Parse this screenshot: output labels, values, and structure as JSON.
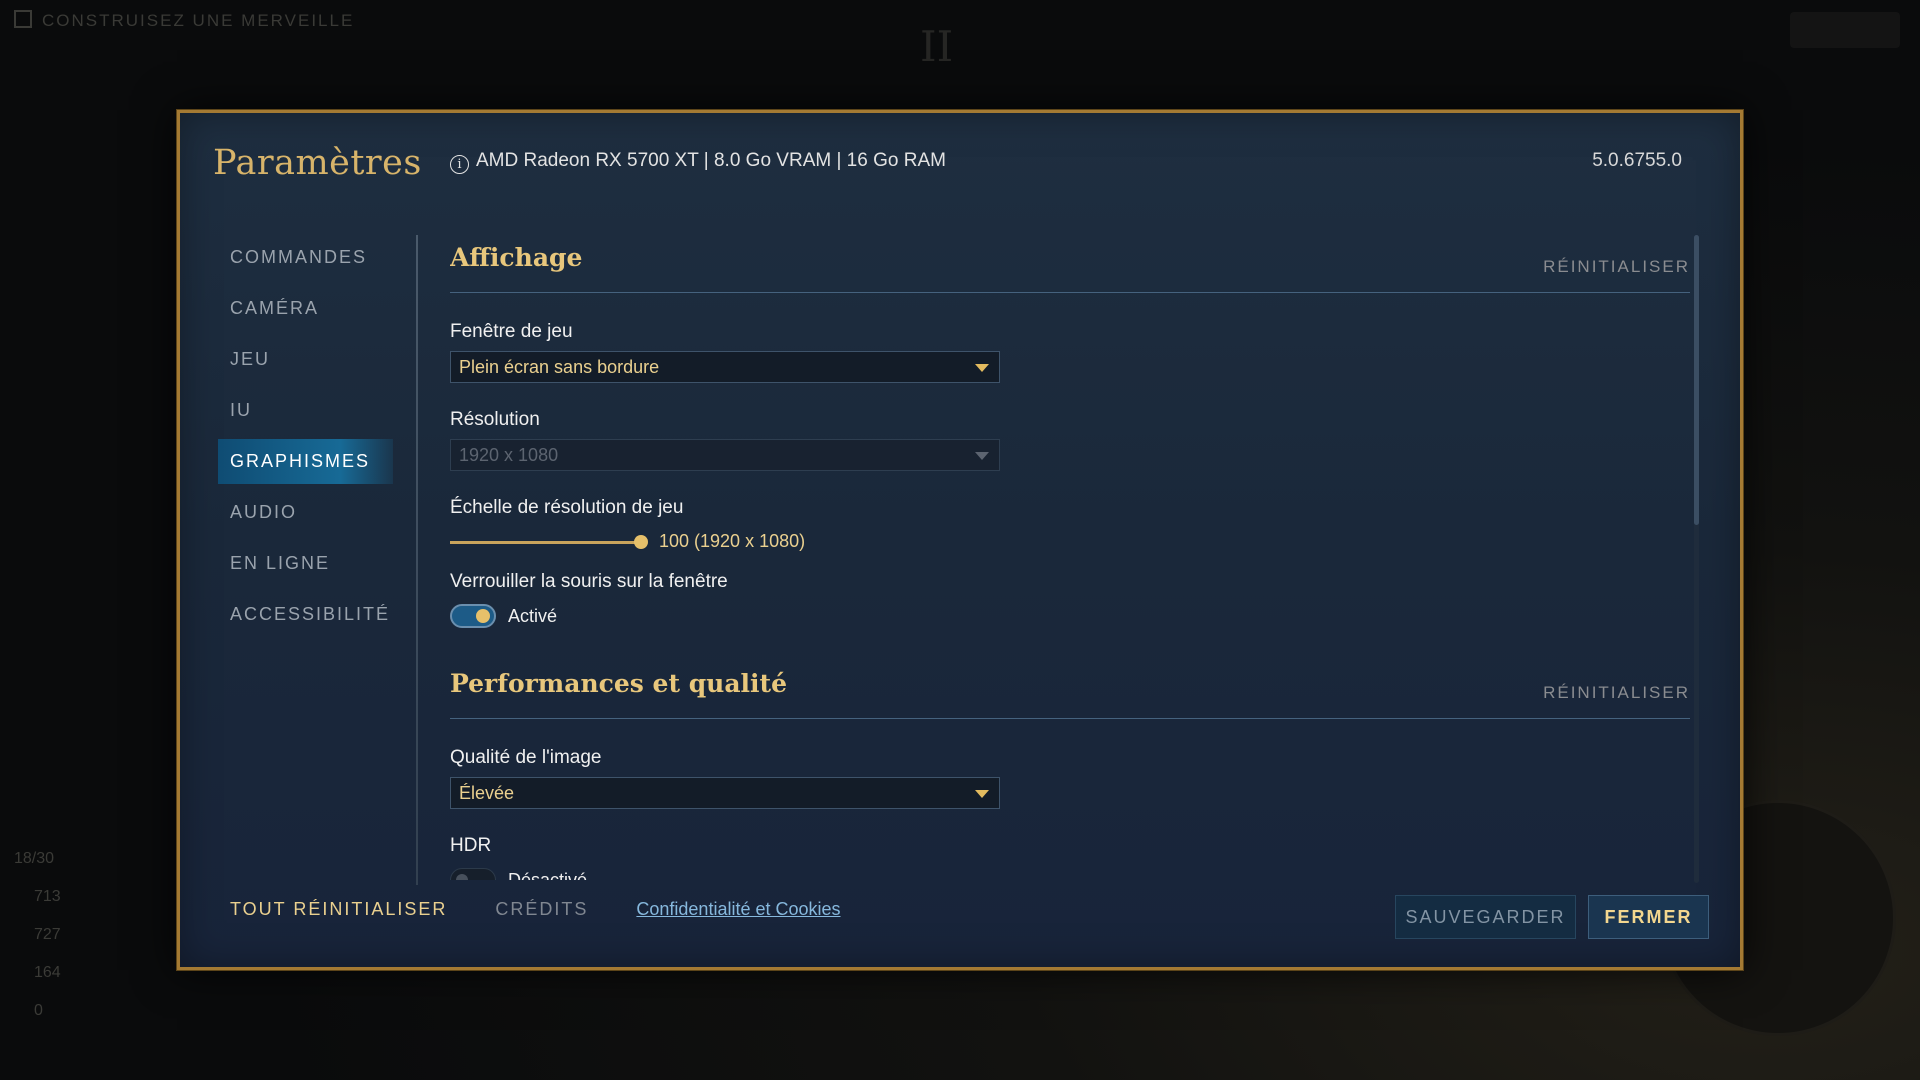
{
  "background": {
    "top_left_text": "CONSTRUISEZ UNE MERVEILLE",
    "top_center": "II",
    "stats": [
      "18/30",
      "713",
      "727",
      "164",
      "0"
    ]
  },
  "modal": {
    "title": "Paramètres",
    "system_info": "AMD Radeon RX 5700 XT | 8.0 Go VRAM | 16 Go RAM",
    "version": "5.0.6755.0"
  },
  "sidebar": {
    "items": [
      {
        "label": "COMMANDES"
      },
      {
        "label": "CAMÉRA"
      },
      {
        "label": "JEU"
      },
      {
        "label": "IU"
      },
      {
        "label": "GRAPHISMES"
      },
      {
        "label": "AUDIO"
      },
      {
        "label": "EN LIGNE"
      },
      {
        "label": "ACCESSIBILITÉ"
      }
    ],
    "active_index": 4
  },
  "sections": {
    "display": {
      "title": "Affichage",
      "reset_label": "RÉINITIALISER",
      "window_label": "Fenêtre de jeu",
      "window_value": "Plein écran sans bordure",
      "resolution_label": "Résolution",
      "resolution_value": "1920 x 1080",
      "scale_label": "Échelle de résolution de jeu",
      "scale_value_text": "100  (1920 x 1080)",
      "scale_fraction": 1.0,
      "mouse_lock_label": "Verrouiller la souris sur la fenêtre",
      "mouse_lock_state": "Activé"
    },
    "performance": {
      "title": "Performances et qualité",
      "reset_label": "RÉINITIALISER",
      "quality_label": "Qualité de l'image",
      "quality_value": "Élevée",
      "hdr_label": "HDR",
      "hdr_state": "Désactivé"
    }
  },
  "footer": {
    "reset_all": "TOUT RÉINITIALISER",
    "credits": "CRÉDITS",
    "privacy": "Confidentialité et Cookies",
    "save": "SAUVEGARDER",
    "close": "FERMER"
  },
  "colors": {
    "accent_gold": "#d8b46a",
    "active_nav": "#176a96",
    "border_gold": "#a47a33"
  }
}
